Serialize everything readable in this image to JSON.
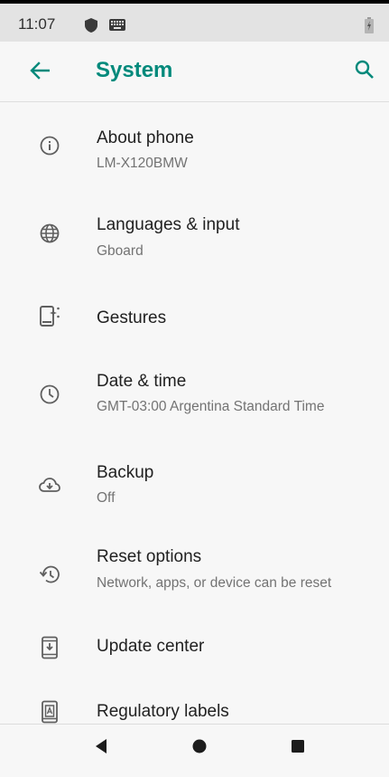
{
  "status": {
    "time": "11:07",
    "icons": [
      "shield-icon",
      "keyboard-icon",
      "battery-charging-icon"
    ]
  },
  "appbar": {
    "title": "System",
    "back_icon": "arrow-back-icon",
    "search_icon": "search-icon",
    "accent_color": "#00897b"
  },
  "items": [
    {
      "title": "About phone",
      "subtitle": "LM-X120BMW",
      "icon": "info-icon"
    },
    {
      "title": "Languages & input",
      "subtitle": "Gboard",
      "icon": "globe-icon"
    },
    {
      "title": "Gestures",
      "subtitle": "",
      "icon": "gestures-icon"
    },
    {
      "title": "Date & time",
      "subtitle": "GMT-03:00 Argentina Standard Time",
      "icon": "clock-icon"
    },
    {
      "title": "Backup",
      "subtitle": "Off",
      "icon": "cloud-backup-icon"
    },
    {
      "title": "Reset options",
      "subtitle": "Network, apps, or device can be reset",
      "icon": "restore-icon"
    },
    {
      "title": "Update center",
      "subtitle": "",
      "icon": "system-update-icon"
    },
    {
      "title": "Regulatory labels",
      "subtitle": "",
      "icon": "regulatory-label-icon"
    }
  ],
  "navbar": {
    "icons": [
      "nav-back-icon",
      "nav-home-icon",
      "nav-recents-icon"
    ]
  }
}
